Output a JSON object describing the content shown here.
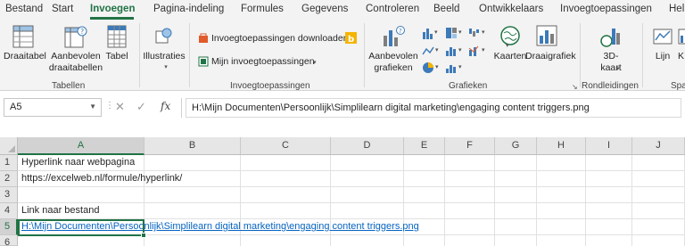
{
  "tabs": [
    "Bestand",
    "Start",
    "Invoegen",
    "Pagina-indeling",
    "Formules",
    "Gegevens",
    "Controleren",
    "Beeld",
    "Ontwikkelaars",
    "Invoegtoepassingen",
    "Help"
  ],
  "active_tab": "Invoegen",
  "ribbon": {
    "tabellen": {
      "group_label": "Tabellen",
      "draaitabel": "Draaitabel",
      "aanbevolen_line1": "Aanbevolen",
      "aanbevolen_line2": "draaitabellen",
      "tabel": "Tabel"
    },
    "illustraties": {
      "label": "Illustraties"
    },
    "invoegtoepassingen": {
      "group_label": "Invoegtoepassingen",
      "download": "Invoegtoepassingen downloaden",
      "mine": "Mijn invoegtoepassingen"
    },
    "grafieken": {
      "group_label": "Grafieken",
      "aanbevolen_line1": "Aanbevolen",
      "aanbevolen_line2": "grafieken",
      "kaarten": "Kaarten",
      "draaigrafiek": "Draaigrafiek"
    },
    "rondleidingen": {
      "group_label": "Rondleidingen",
      "kaart_line1": "3D-",
      "kaart_line2": "kaart"
    },
    "sparklines": {
      "group_label": "Spa",
      "lijn": "Lijn",
      "kolom_partial": "K"
    }
  },
  "formula_bar": {
    "name_box": "A5",
    "fx": "fx",
    "cancel": "✕",
    "enter": "✓",
    "formula": "H:\\Mijn Documenten\\Persoonlijk\\Simplilearn digital marketing\\engaging content triggers.png"
  },
  "columns": [
    "A",
    "B",
    "C",
    "D",
    "E",
    "F",
    "G",
    "H",
    "I",
    "J"
  ],
  "selected_column": "A",
  "rows": [
    "1",
    "2",
    "3",
    "4",
    "5",
    "6"
  ],
  "selected_row": "5",
  "cells": {
    "A1": "Hyperlink naar webpagina",
    "A2": "https://excelweb.nl/formule/hyperlink/",
    "A4": "Link naar bestand",
    "A5": "H:\\Mijn Documenten\\Persoonlijk\\Simplilearn digital marketing\\engaging content triggers.png"
  },
  "colors": {
    "accent": "#217346",
    "hyperlink": "#0563c1"
  }
}
